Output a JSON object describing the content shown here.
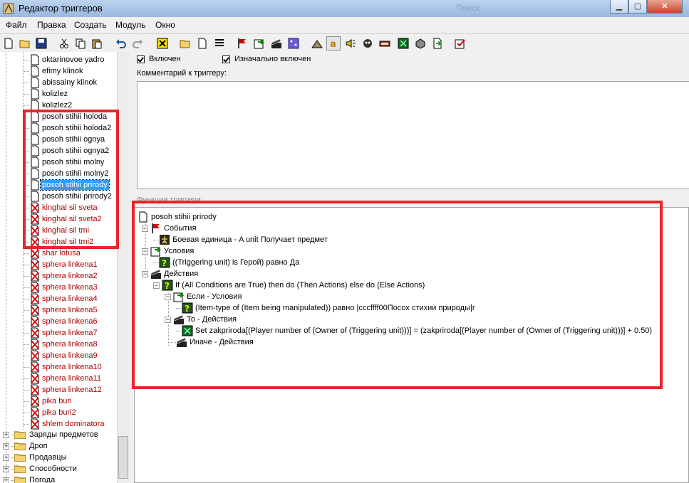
{
  "window": {
    "title": "Редактор триггеров",
    "ghost_title": "Поиск"
  },
  "menu": [
    "Файл",
    "Правка",
    "Создать",
    "Модуль",
    "Окно"
  ],
  "toolbar": {
    "icons": [
      "new-icon",
      "open-icon",
      "save-icon",
      "cut-icon",
      "copy-icon",
      "paste-icon",
      "undo-icon",
      "redo-icon",
      "delete-icon",
      "new-category-icon",
      "new-trigger-icon",
      "new-comment-icon",
      "new-event-icon",
      "new-condition-icon",
      "new-action-icon",
      "variables-icon",
      "text-icon",
      "sound-icon",
      "model-icon",
      "unit-icon",
      "import-icon",
      "objects-icon",
      "test-map-icon",
      "disabled-icon"
    ]
  },
  "tree": {
    "items": [
      {
        "label": "oktarinovoe yadro",
        "red": false
      },
      {
        "label": "efimy klinok",
        "red": false
      },
      {
        "label": "abissalny klinok",
        "red": false
      },
      {
        "label": "kolizlez",
        "red": false
      },
      {
        "label": "kolizlez2",
        "red": false
      },
      {
        "label": "posoh stihii holoda",
        "red": false
      },
      {
        "label": "posoh stihii holoda2",
        "red": false
      },
      {
        "label": "posoh stihii ognya",
        "red": false
      },
      {
        "label": "posoh stihii ognya2",
        "red": false
      },
      {
        "label": "posoh stihii molny",
        "red": false
      },
      {
        "label": "posoh stihii molny2",
        "red": false
      },
      {
        "label": "posoh stihii prirody",
        "red": false,
        "selected": true
      },
      {
        "label": "posoh stihii prirody2",
        "red": false
      },
      {
        "label": "kinghal sil sveta",
        "red": true
      },
      {
        "label": "kinghal sil sveta2",
        "red": true
      },
      {
        "label": "kinghal sil tmi",
        "red": true
      },
      {
        "label": "kinghal sil tmi2",
        "red": true
      },
      {
        "label": "shar lotusa",
        "red": true
      },
      {
        "label": "sphera linkena1",
        "red": true
      },
      {
        "label": "sphera linkena2",
        "red": true
      },
      {
        "label": "sphera linkena3",
        "red": true
      },
      {
        "label": "sphera linkena4",
        "red": true
      },
      {
        "label": "sphera linkena5",
        "red": true
      },
      {
        "label": "sphera linkena6",
        "red": true
      },
      {
        "label": "sphera linkena7",
        "red": true
      },
      {
        "label": "sphera linkena8",
        "red": true
      },
      {
        "label": "sphera linkena9",
        "red": true
      },
      {
        "label": "sphera linkena10",
        "red": true
      },
      {
        "label": "sphera linkena11",
        "red": true
      },
      {
        "label": "sphera linkena12",
        "red": true
      },
      {
        "label": "pika buri",
        "red": true
      },
      {
        "label": "pika buri2",
        "red": true
      },
      {
        "label": "shlem dominatora",
        "red": true
      }
    ],
    "folders": [
      "Заряды предметов",
      "Дроп",
      "Продавцы",
      "Способности",
      "Погода"
    ]
  },
  "options": {
    "enabled_label": "Включен",
    "initially_enabled_label": "Изначально включен"
  },
  "comment": {
    "label": "Комментарий к триггеру:"
  },
  "functions": {
    "label": "Функции триггера:",
    "trigger_name": "posoh stihii prirody",
    "events_label": "События",
    "event_1": "Боевая единица - A unit Получает предмет",
    "conditions_label": "Условия",
    "condition_1": "((Triggering unit) is Герой) равно Да",
    "actions_label": "Действия",
    "if_action": "If (All Conditions are True) then do (Then Actions) else do (Else Actions)",
    "if_conditions_label": "Если - Условия",
    "if_condition_1": "(Item-type of (Item being manipulated)) равно |cccffff00Посох стихии природы|r",
    "then_label": "То - Действия",
    "then_action_1": "Set zakpriroda[(Player number of (Owner of (Triggering unit)))] = (zakpriroda[(Player number of (Owner of (Triggering unit)))] + 0.50)",
    "else_label": "Иначе - Действия"
  }
}
